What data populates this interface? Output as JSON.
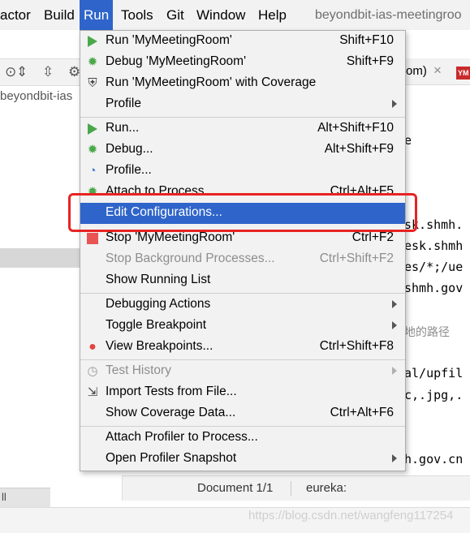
{
  "menubar": {
    "items": [
      "actor",
      "Build",
      "Run",
      "Tools",
      "Git",
      "Window",
      "Help"
    ],
    "active": "Run",
    "window_title": "beyondbit-ias-meetingroo"
  },
  "project_panel": {
    "path_text": "beyondbit-ias",
    "bottom_text": "ll"
  },
  "editor": {
    "tab_label": "om)",
    "tab_badge": "YM",
    "code_lines": [
      {
        "text": "e",
        "style": "code"
      },
      {
        "text": "sk.shmh.",
        "style": "code"
      },
      {
        "text": "esk.shmh",
        "style": "code"
      },
      {
        "text": "es/*;/ue",
        "style": "code"
      },
      {
        "text": "shmh.gov",
        "style": "code"
      },
      {
        "text": "地的路径",
        "style": "comment"
      },
      {
        "text": "al/upfil",
        "style": "code"
      },
      {
        "text": "c,.jpg,.",
        "style": "code"
      },
      {
        "text": "h.gov.cn",
        "style": "code"
      }
    ]
  },
  "statusbar": {
    "doc": "Document 1/1",
    "context": "eureka:"
  },
  "watermark": "https://blog.csdn.net/wangfeng117254",
  "run_menu": {
    "items": [
      {
        "label": "Run 'MyMeetingRoom'",
        "shortcut": "Shift+F10",
        "icon": "run-icon"
      },
      {
        "label": "Debug 'MyMeetingRoom'",
        "shortcut": "Shift+F9",
        "icon": "debug-icon"
      },
      {
        "label": "Run 'MyMeetingRoom' with Coverage",
        "shortcut": "",
        "icon": "coverage-icon"
      },
      {
        "label": "Profile",
        "shortcut": "",
        "icon": "",
        "submenu": true
      },
      {
        "label": "Run...",
        "shortcut": "Alt+Shift+F10",
        "icon": "run-icon"
      },
      {
        "label": "Debug...",
        "shortcut": "Alt+Shift+F9",
        "icon": "debug-icon"
      },
      {
        "label": "Profile...",
        "shortcut": "",
        "icon": "profiler-icon"
      },
      {
        "label": "Attach to Process...",
        "shortcut": "Ctrl+Alt+F5",
        "icon": "attach-icon"
      },
      {
        "label": "Edit Configurations...",
        "shortcut": "",
        "icon": "",
        "selected": true
      },
      {
        "label": "Stop 'MyMeetingRoom'",
        "shortcut": "Ctrl+F2",
        "icon": "stop-icon"
      },
      {
        "label": "Stop Background Processes...",
        "shortcut": "Ctrl+Shift+F2",
        "icon": "",
        "disabled": true
      },
      {
        "label": "Show Running List",
        "shortcut": "",
        "icon": ""
      },
      {
        "label": "Debugging Actions",
        "shortcut": "",
        "icon": "",
        "submenu": true
      },
      {
        "label": "Toggle Breakpoint",
        "shortcut": "",
        "icon": "",
        "submenu": true
      },
      {
        "label": "View Breakpoints...",
        "shortcut": "Ctrl+Shift+F8",
        "icon": "breakpoints-icon"
      },
      {
        "label": "Test History",
        "shortcut": "",
        "icon": "history-icon",
        "submenu": true,
        "disabled": true
      },
      {
        "label": "Import Tests from File...",
        "shortcut": "",
        "icon": "import-icon"
      },
      {
        "label": "Show Coverage Data...",
        "shortcut": "Ctrl+Alt+F6",
        "icon": ""
      },
      {
        "label": "Attach Profiler to Process...",
        "shortcut": "",
        "icon": ""
      },
      {
        "label": "Open Profiler Snapshot",
        "shortcut": "",
        "icon": "",
        "submenu": true
      }
    ]
  },
  "colors": {
    "menu_selection": "#2f65ca",
    "run_green": "#4aa84a",
    "stop_red": "#e85454",
    "annotation_red": "#e82323"
  }
}
